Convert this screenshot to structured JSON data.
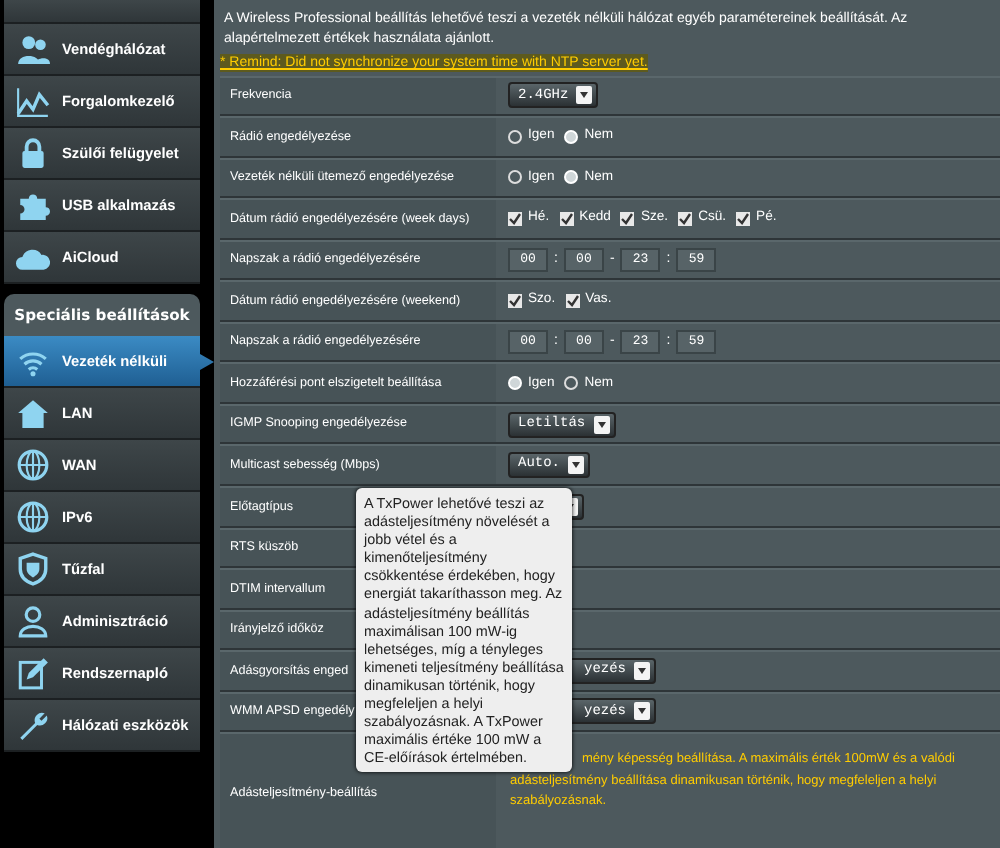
{
  "sidebar": {
    "items": [
      {
        "label": "Vendéghálózat",
        "selected": false
      },
      {
        "label": "Forgalomkezelő",
        "selected": false
      },
      {
        "label": "Szülői felügyelet",
        "selected": false
      },
      {
        "label": "USB alkalmazás",
        "selected": false
      },
      {
        "label": "AiCloud",
        "selected": false
      }
    ],
    "section": "Speciális beállítások",
    "section_items": [
      {
        "label": "Vezeték nélküli",
        "selected": true
      },
      {
        "label": "LAN",
        "selected": false
      },
      {
        "label": "WAN",
        "selected": false
      },
      {
        "label": "IPv6",
        "selected": false
      },
      {
        "label": "Tűzfal",
        "selected": false
      },
      {
        "label": "Adminisztráció",
        "selected": false
      },
      {
        "label": "Rendszernapló",
        "selected": false
      },
      {
        "label": "Hálózati eszközök",
        "selected": false
      }
    ]
  },
  "page": {
    "description": "A Wireless Professional beállítás lehetővé teszi a vezeték nélküli hálózat egyéb paramétereinek beállítását. Az alapértelmezett értékek használata ajánlott.",
    "notice": "* Remind: Did not synchronize your system time with NTP server yet."
  },
  "settings": [
    {
      "label": "Frekvencia",
      "kind": "select",
      "value": "2.4GHz"
    },
    {
      "label": "Rádió engedélyezése",
      "kind": "radio",
      "options": [
        {
          "label": "Igen",
          "selected": false
        },
        {
          "label": "Nem",
          "selected": true
        }
      ]
    },
    {
      "label": "Vezeték nélküli ütemező engedélyezése",
      "kind": "radio",
      "options": [
        {
          "label": "Igen",
          "selected": false
        },
        {
          "label": "Nem",
          "selected": true
        }
      ]
    },
    {
      "label": "Dátum rádió engedélyezésére (week days)",
      "kind": "checks",
      "options": [
        {
          "label": "Hé.",
          "checked": true
        },
        {
          "label": "Kedd",
          "checked": true
        },
        {
          "label": "Sze.",
          "checked": true
        },
        {
          "label": "Csü.",
          "checked": true
        },
        {
          "label": "Pé.",
          "checked": true
        }
      ]
    },
    {
      "label": "Napszak a rádió engedélyezésére",
      "kind": "time",
      "parts": [
        "00",
        ":",
        "00",
        "-",
        "23",
        ":",
        "59"
      ]
    },
    {
      "label": "Dátum rádió engedélyezésére (weekend)",
      "kind": "checks",
      "options": [
        {
          "label": "Szo.",
          "checked": true
        },
        {
          "label": "Vas.",
          "checked": true
        }
      ]
    },
    {
      "label": "Napszak a rádió engedélyezésére",
      "kind": "time",
      "parts": [
        "00",
        ":",
        "00",
        "-",
        "23",
        ":",
        "59"
      ]
    },
    {
      "label": "Hozzáférési pont elszigetelt beállítása",
      "kind": "radio",
      "options": [
        {
          "label": "Igen",
          "selected": true
        },
        {
          "label": "Nem",
          "selected": false
        }
      ]
    },
    {
      "label": "IGMP Snooping engedélyezése",
      "kind": "select",
      "value": "Letiltás"
    },
    {
      "label": "Multicast sebesség (Mbps)",
      "kind": "select",
      "value": "Auto."
    },
    {
      "label": "Előtagtípus",
      "kind": "covered"
    },
    {
      "label": "RTS küszöb",
      "kind": "blank"
    },
    {
      "label": "DTIM intervallum",
      "kind": "blank"
    },
    {
      "label": "Irányjelző időköz",
      "kind": "blank"
    },
    {
      "label": "Adásgyorsítás enged",
      "kind": "select_tail",
      "value": "yezés"
    },
    {
      "label": "WMM APSD engedély",
      "kind": "select_tail",
      "value": "yezés"
    },
    {
      "label": "Adásteljesítmény-beállítás",
      "kind": "note",
      "lines": [
        "mény képesség beállítása. A maximális érték 100mW és a valódi",
        "adásteljesítmény beállítása dinamikusan történik, hogy megfeleljen a helyi szabályozásnak."
      ]
    }
  ],
  "tooltip": "A TxPower lehetővé teszi az adásteljesítmény növelését a jobb vétel és a kimenőteljesítmény csökkentése érdekében, hogy energiát takaríthasson meg. Az adásteljesítmény beállítás maximálisan 100 mW-ig lehetséges, míg a tényleges kimeneti teljesítmény beállítása dinamikusan történik, hogy megfeleljen a helyi szabályozásnak. A TxPower maximális értéke 100 mW a CE-előírások értelmében."
}
